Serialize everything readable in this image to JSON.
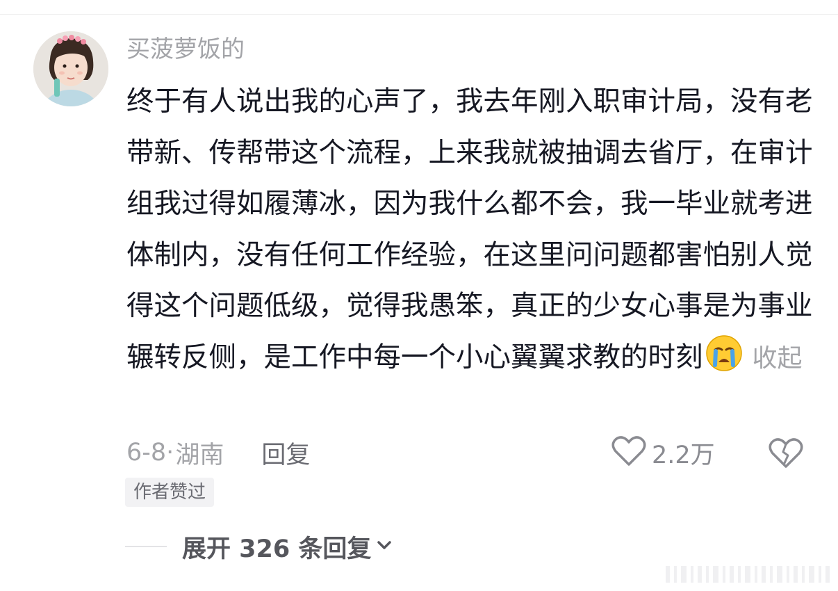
{
  "comment": {
    "username": "买菠萝饭的",
    "text": "终于有人说出我的心声了，我去年刚入职审计局，没有老带新、传帮带这个流程，上来我就被抽调去省厅，在审计组我过得如履薄冰，因为我什么都不会，我一毕业就考进体制内，没有任何工作经验，在这里问问题都害怕别人觉得这个问题低级，觉得我愚笨，真正的少女心事是为事业辗转反侧，是工作中每一个小心翼翼求教的时刻",
    "emoji_icon": "crying-face-emoji",
    "collapse_label": "收起",
    "date": "6-8",
    "separator": "·",
    "location": "湖南",
    "reply_label": "回复",
    "like_icon": "heart-outline-icon",
    "like_count": "2.2万",
    "dislike_icon": "broken-heart-icon",
    "author_badge": "作者赞过"
  },
  "replies": {
    "expand_label": "展开 326 条回复",
    "expand_icon": "chevron-down-icon"
  },
  "colors": {
    "text_primary": "#161823",
    "text_secondary": "#a3a4a8",
    "reply_link": "#6a6b72",
    "badge_bg": "#f2f2f4",
    "expand_text": "#55565c"
  }
}
